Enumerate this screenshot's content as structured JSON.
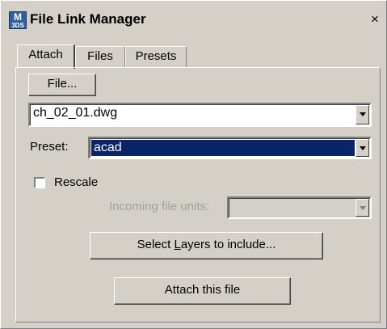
{
  "window": {
    "title": "File Link Manager",
    "close_glyph": "×",
    "icon_top": "M",
    "icon_bottom": "3DS"
  },
  "tabs": [
    {
      "label": "Attach",
      "active": true
    },
    {
      "label": "Files",
      "active": false
    },
    {
      "label": "Presets",
      "active": false
    }
  ],
  "attach": {
    "file_button": "File...",
    "file_combo_value": "ch_02_01.dwg",
    "preset_label": "Preset:",
    "preset_value": "acad",
    "rescale_label": "Rescale",
    "rescale_checked": false,
    "incoming_units_label": "Incoming file units:",
    "incoming_units_value": "",
    "select_layers_prefix": "Select ",
    "select_layers_accel": "L",
    "select_layers_suffix": "ayers to include...",
    "attach_button": "Attach this file"
  },
  "colors": {
    "dialog_bg": "#d4d0c8",
    "selection_bg": "#0a246a",
    "disabled_text": "#a0a0a0"
  }
}
